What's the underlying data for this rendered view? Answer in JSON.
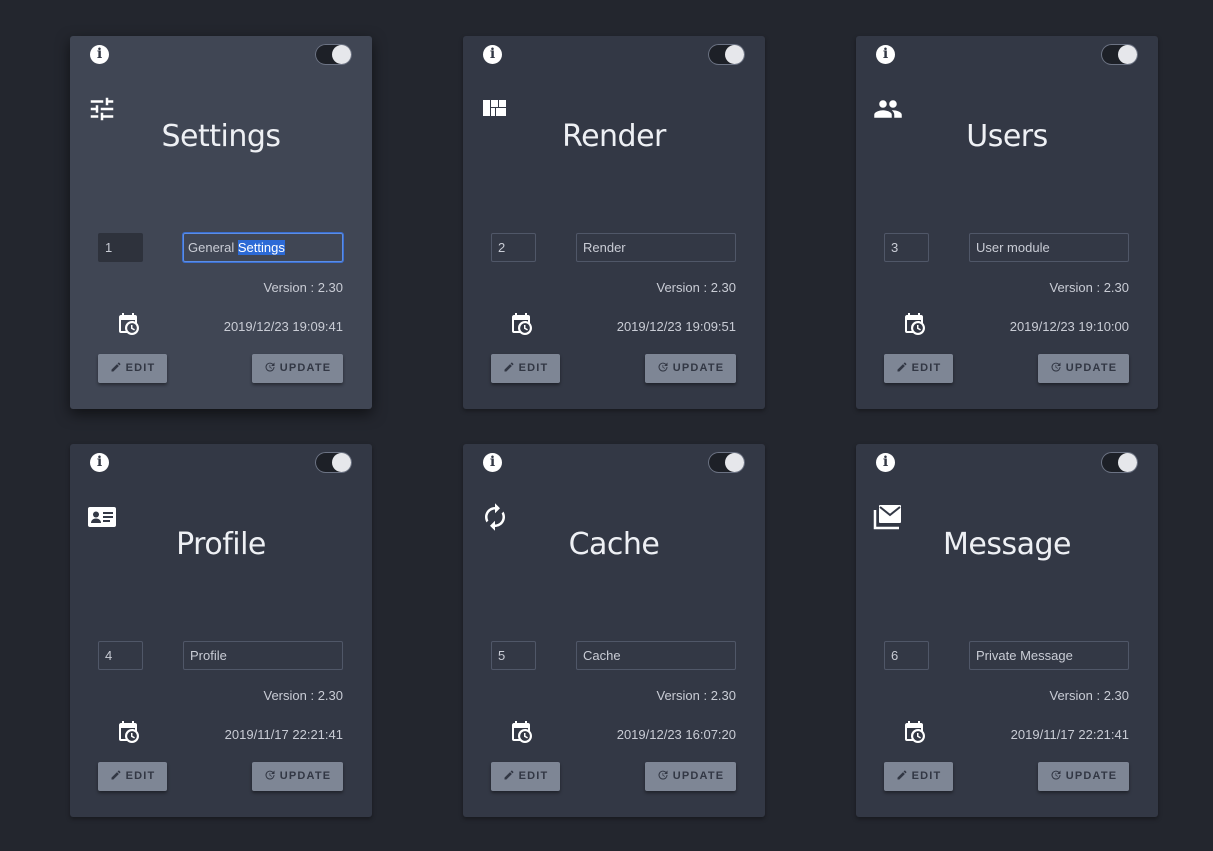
{
  "cards": [
    {
      "id_value": "1",
      "name_value": "General Settings",
      "name_prefix": "General ",
      "name_selected": "Settings",
      "title": "Settings",
      "icon": "sliders-icon",
      "version": "Version : 2.30",
      "timestamp": "2019/12/23 19:09:41",
      "active": true,
      "toggle_on": true
    },
    {
      "id_value": "2",
      "name_value": "Render",
      "title": "Render",
      "icon": "dashboard-icon",
      "version": "Version : 2.30",
      "timestamp": "2019/12/23 19:09:51",
      "toggle_on": true
    },
    {
      "id_value": "3",
      "name_value": "User module",
      "title": "Users",
      "icon": "users-icon",
      "version": "Version : 2.30",
      "timestamp": "2019/12/23 19:10:00",
      "toggle_on": true
    },
    {
      "id_value": "4",
      "name_value": "Profile",
      "title": "Profile",
      "icon": "id-card-icon",
      "version": "Version : 2.30",
      "timestamp": "2019/11/17 22:21:41",
      "toggle_on": true
    },
    {
      "id_value": "5",
      "name_value": "Cache",
      "title": "Cache",
      "icon": "refresh-icon",
      "version": "Version : 2.30",
      "timestamp": "2019/12/23 16:07:20",
      "toggle_on": true
    },
    {
      "id_value": "6",
      "name_value": "Private Message",
      "title": "Message",
      "icon": "mail-icon",
      "version": "Version : 2.30",
      "timestamp": "2019/11/17 22:21:41",
      "toggle_on": true
    }
  ],
  "buttons": {
    "edit_label": "EDIT",
    "update_label": "UPDATE"
  },
  "colors": {
    "background": "#23262e",
    "card": "#333845",
    "card_active": "#404654",
    "button": "#7e8695",
    "focus_border": "#5b8de6",
    "selection": "#2c6ad6"
  }
}
